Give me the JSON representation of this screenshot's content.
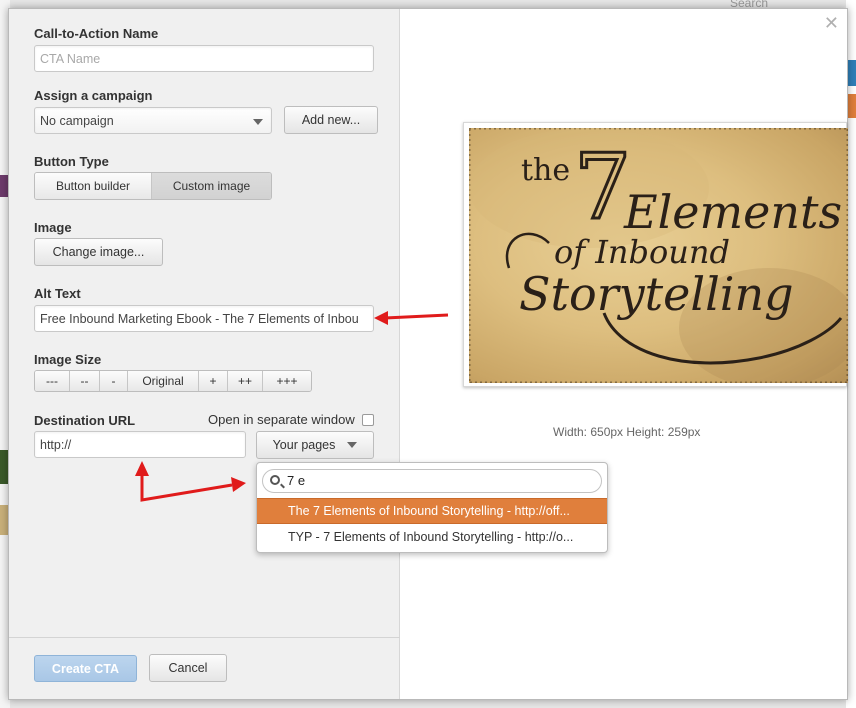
{
  "background": {
    "search_label": "Search"
  },
  "form": {
    "cta_name": {
      "label": "Call-to-Action Name",
      "placeholder": "CTA Name",
      "value": ""
    },
    "campaign": {
      "label": "Assign a campaign",
      "selected": "No campaign",
      "add_button": "Add new..."
    },
    "button_type": {
      "label": "Button Type",
      "options": [
        "Button builder",
        "Custom image"
      ],
      "selected": "Custom image"
    },
    "image": {
      "label": "Image",
      "change_button": "Change image..."
    },
    "alt_text": {
      "label": "Alt Text",
      "value": "Free Inbound Marketing Ebook - The 7 Elements of Inbou"
    },
    "image_size": {
      "label": "Image Size",
      "options": [
        "---",
        "--",
        "-",
        "Original",
        "+",
        "++",
        "+++"
      ]
    },
    "destination": {
      "label": "Destination URL",
      "value": "http://",
      "open_separate_label": "Open in separate window",
      "open_separate_checked": false,
      "your_pages_button": "Your pages"
    }
  },
  "page_dropdown": {
    "search_value": "7 e",
    "items": [
      {
        "label": "The 7 Elements of Inbound Storytelling - http://off...",
        "highlighted": true
      },
      {
        "label": "TYP - 7 Elements of Inbound Storytelling - http://o...",
        "highlighted": false
      }
    ]
  },
  "footer": {
    "create_button": "Create CTA",
    "cancel_button": "Cancel"
  },
  "preview": {
    "caption": "Width: 650px Height: 259px",
    "image_text": {
      "line1": "the",
      "line2": "7",
      "line3": "Elements",
      "line4": "of Inbound",
      "line5": "Storytelling"
    }
  },
  "colors": {
    "highlight": "#e07f3c",
    "arrow": "#e01b1b",
    "primary_button": "#a9c7e6"
  },
  "icons": {
    "close": "close-icon",
    "search": "search-icon",
    "caret": "chevron-down-icon"
  }
}
